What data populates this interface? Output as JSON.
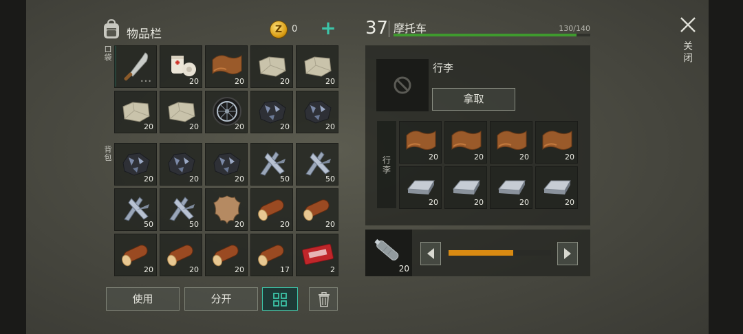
{
  "inventory": {
    "title": "物品栏",
    "coins": "0",
    "pocket_label": "口袋",
    "backpack_label": "背包",
    "pocket_slots": [
      {
        "icon": "machete-icon",
        "qty": ""
      },
      {
        "icon": "bandage-icon",
        "qty": "20"
      },
      {
        "icon": "leather-icon",
        "qty": "20"
      },
      {
        "icon": "stone-icon",
        "qty": "20"
      },
      {
        "icon": "stone-icon",
        "qty": "20"
      },
      {
        "icon": "stone-icon",
        "qty": "20"
      },
      {
        "icon": "stone-icon",
        "qty": "20"
      },
      {
        "icon": "tire-icon",
        "qty": "20"
      },
      {
        "icon": "iron-ore-icon",
        "qty": "20"
      },
      {
        "icon": "iron-ore-icon",
        "qty": "20"
      }
    ],
    "backpack_slots": [
      {
        "icon": "iron-ore-icon",
        "qty": "20"
      },
      {
        "icon": "iron-ore-icon",
        "qty": "20"
      },
      {
        "icon": "iron-ore-icon",
        "qty": "20"
      },
      {
        "icon": "metal-scrap-icon",
        "qty": "50"
      },
      {
        "icon": "metal-scrap-icon",
        "qty": "50"
      },
      {
        "icon": "metal-scrap-icon",
        "qty": "50"
      },
      {
        "icon": "metal-scrap-icon",
        "qty": "50"
      },
      {
        "icon": "hide-icon",
        "qty": "20"
      },
      {
        "icon": "log-icon",
        "qty": "20"
      },
      {
        "icon": "log-icon",
        "qty": "20"
      },
      {
        "icon": "log-icon",
        "qty": "20"
      },
      {
        "icon": "log-icon",
        "qty": "20"
      },
      {
        "icon": "log-icon",
        "qty": "20"
      },
      {
        "icon": "log-icon",
        "qty": "17"
      },
      {
        "icon": "coupon-icon",
        "qty": "2"
      }
    ],
    "buttons": {
      "use": "使用",
      "split": "分开"
    }
  },
  "vehicle": {
    "level": "37",
    "name": "摩托车",
    "durability_text": "130/140",
    "durability_fraction": 0.929,
    "trunk_title": "行李",
    "take_label": "拿取",
    "trunk_side_label": "行李",
    "trunk_slots": [
      {
        "icon": "leather-icon",
        "qty": "20"
      },
      {
        "icon": "leather-icon",
        "qty": "20"
      },
      {
        "icon": "leather-icon",
        "qty": "20"
      },
      {
        "icon": "leather-icon",
        "qty": "20"
      },
      {
        "icon": "iron-ingot-icon",
        "qty": "20"
      },
      {
        "icon": "iron-ingot-icon",
        "qty": "20"
      },
      {
        "icon": "iron-ingot-icon",
        "qty": "20"
      },
      {
        "icon": "iron-ingot-icon",
        "qty": "20"
      }
    ],
    "fuel": {
      "icon": "bottle-icon",
      "qty": "20",
      "level_fraction": 0.63
    }
  },
  "close_label": "关闭",
  "colors": {
    "accent": "#3cc4a8",
    "durability": "#3f9a2e",
    "fuel": "#d98a12"
  }
}
